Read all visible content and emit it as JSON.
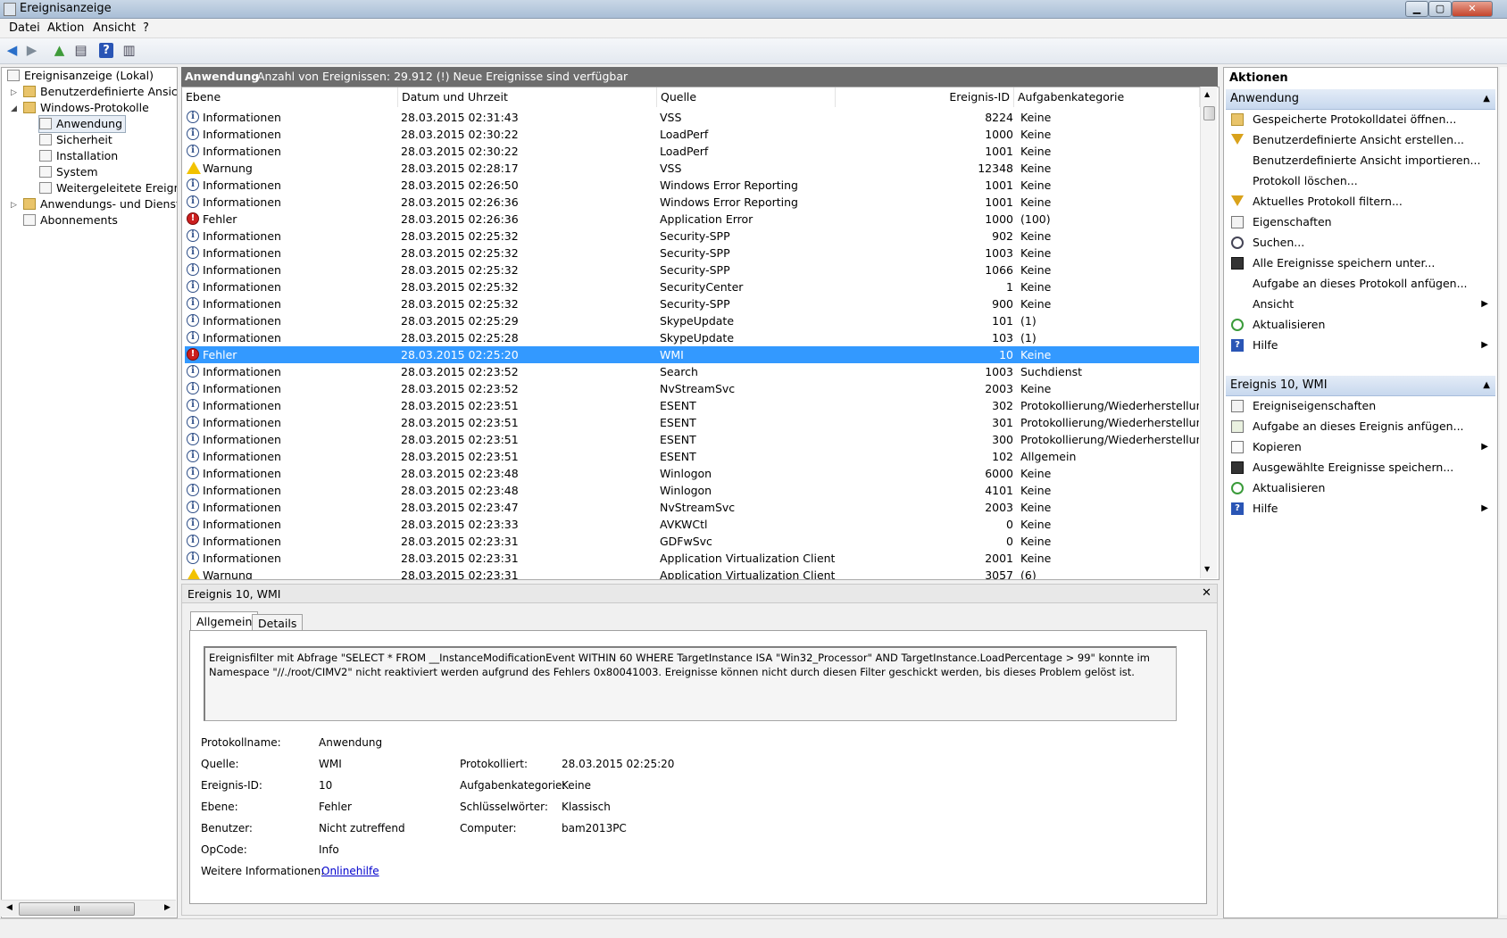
{
  "window": {
    "title": "Ereignisanzeige",
    "min": "▁",
    "max": "▢",
    "close": "✕"
  },
  "menu": [
    "Datei",
    "Aktion",
    "Ansicht",
    "?"
  ],
  "toolbar": {
    "back": "◀",
    "forward": "▶",
    "up": "▲",
    "console": "▤",
    "help": "?",
    "panel": "▥"
  },
  "tree": {
    "root": "Ereignisanzeige (Lokal)",
    "custom_views": "Benutzerdefinierte Ansichten",
    "windows_logs": "Windows-Protokolle",
    "logs": [
      "Anwendung",
      "Sicherheit",
      "Installation",
      "System",
      "Weitergeleitete Ereignisse"
    ],
    "app_services": "Anwendungs- und Dienstprotokolle",
    "subscriptions": "Abonnements",
    "scroll_grip": "III"
  },
  "center_header": {
    "name": "Anwendung",
    "info": "Anzahl von Ereignissen: 29.912 (!) Neue Ereignisse sind verfügbar"
  },
  "columns": [
    "Ebene",
    "Datum und Uhrzeit",
    "Quelle",
    "Ereignis-ID",
    "Aufgabenkategorie"
  ],
  "events": [
    {
      "level": "Informationen",
      "type": "info",
      "date": "28.03.2015 02:31:43",
      "source": "VSS",
      "id": "8224",
      "cat": "Keine"
    },
    {
      "level": "Informationen",
      "type": "info",
      "date": "28.03.2015 02:30:22",
      "source": "LoadPerf",
      "id": "1000",
      "cat": "Keine"
    },
    {
      "level": "Informationen",
      "type": "info",
      "date": "28.03.2015 02:30:22",
      "source": "LoadPerf",
      "id": "1001",
      "cat": "Keine"
    },
    {
      "level": "Warnung",
      "type": "warn",
      "date": "28.03.2015 02:28:17",
      "source": "VSS",
      "id": "12348",
      "cat": "Keine"
    },
    {
      "level": "Informationen",
      "type": "info",
      "date": "28.03.2015 02:26:50",
      "source": "Windows Error Reporting",
      "id": "1001",
      "cat": "Keine"
    },
    {
      "level": "Informationen",
      "type": "info",
      "date": "28.03.2015 02:26:36",
      "source": "Windows Error Reporting",
      "id": "1001",
      "cat": "Keine"
    },
    {
      "level": "Fehler",
      "type": "err",
      "date": "28.03.2015 02:26:36",
      "source": "Application Error",
      "id": "1000",
      "cat": "(100)"
    },
    {
      "level": "Informationen",
      "type": "info",
      "date": "28.03.2015 02:25:32",
      "source": "Security-SPP",
      "id": "902",
      "cat": "Keine"
    },
    {
      "level": "Informationen",
      "type": "info",
      "date": "28.03.2015 02:25:32",
      "source": "Security-SPP",
      "id": "1003",
      "cat": "Keine"
    },
    {
      "level": "Informationen",
      "type": "info",
      "date": "28.03.2015 02:25:32",
      "source": "Security-SPP",
      "id": "1066",
      "cat": "Keine"
    },
    {
      "level": "Informationen",
      "type": "info",
      "date": "28.03.2015 02:25:32",
      "source": "SecurityCenter",
      "id": "1",
      "cat": "Keine"
    },
    {
      "level": "Informationen",
      "type": "info",
      "date": "28.03.2015 02:25:32",
      "source": "Security-SPP",
      "id": "900",
      "cat": "Keine"
    },
    {
      "level": "Informationen",
      "type": "info",
      "date": "28.03.2015 02:25:29",
      "source": "SkypeUpdate",
      "id": "101",
      "cat": "(1)"
    },
    {
      "level": "Informationen",
      "type": "info",
      "date": "28.03.2015 02:25:28",
      "source": "SkypeUpdate",
      "id": "103",
      "cat": "(1)"
    },
    {
      "level": "Fehler",
      "type": "err",
      "date": "28.03.2015 02:25:20",
      "source": "WMI",
      "id": "10",
      "cat": "Keine",
      "selected": true
    },
    {
      "level": "Informationen",
      "type": "info",
      "date": "28.03.2015 02:23:52",
      "source": "Search",
      "id": "1003",
      "cat": "Suchdienst"
    },
    {
      "level": "Informationen",
      "type": "info",
      "date": "28.03.2015 02:23:52",
      "source": "NvStreamSvc",
      "id": "2003",
      "cat": "Keine"
    },
    {
      "level": "Informationen",
      "type": "info",
      "date": "28.03.2015 02:23:51",
      "source": "ESENT",
      "id": "302",
      "cat": "Protokollierung/Wiederherstellung"
    },
    {
      "level": "Informationen",
      "type": "info",
      "date": "28.03.2015 02:23:51",
      "source": "ESENT",
      "id": "301",
      "cat": "Protokollierung/Wiederherstellung"
    },
    {
      "level": "Informationen",
      "type": "info",
      "date": "28.03.2015 02:23:51",
      "source": "ESENT",
      "id": "300",
      "cat": "Protokollierung/Wiederherstellung"
    },
    {
      "level": "Informationen",
      "type": "info",
      "date": "28.03.2015 02:23:51",
      "source": "ESENT",
      "id": "102",
      "cat": "Allgemein"
    },
    {
      "level": "Informationen",
      "type": "info",
      "date": "28.03.2015 02:23:48",
      "source": "Winlogon",
      "id": "6000",
      "cat": "Keine"
    },
    {
      "level": "Informationen",
      "type": "info",
      "date": "28.03.2015 02:23:48",
      "source": "Winlogon",
      "id": "4101",
      "cat": "Keine"
    },
    {
      "level": "Informationen",
      "type": "info",
      "date": "28.03.2015 02:23:47",
      "source": "NvStreamSvc",
      "id": "2003",
      "cat": "Keine"
    },
    {
      "level": "Informationen",
      "type": "info",
      "date": "28.03.2015 02:23:33",
      "source": "AVKWCtl",
      "id": "0",
      "cat": "Keine"
    },
    {
      "level": "Informationen",
      "type": "info",
      "date": "28.03.2015 02:23:31",
      "source": "GDFwSvc",
      "id": "0",
      "cat": "Keine"
    },
    {
      "level": "Informationen",
      "type": "info",
      "date": "28.03.2015 02:23:31",
      "source": "Application Virtualization Client",
      "id": "2001",
      "cat": "Keine"
    },
    {
      "level": "Warnung",
      "type": "warn",
      "date": "28.03.2015 02:23:31",
      "source": "Application Virtualization Client",
      "id": "3057",
      "cat": "(6)"
    }
  ],
  "detail": {
    "title": "Ereignis 10, WMI",
    "close": "✕",
    "tabs": [
      "Allgemein",
      "Details"
    ],
    "description": "Ereignisfilter mit Abfrage \"SELECT * FROM __InstanceModificationEvent WITHIN 60 WHERE TargetInstance ISA \"Win32_Processor\" AND TargetInstance.LoadPercentage > 99\" konnte im Namespace \"//./root/CIMV2\" nicht reaktiviert werden aufgrund des Fehlers 0x80041003. Ereignisse können nicht durch diesen Filter geschickt werden, bis dieses Problem gelöst ist.",
    "labels": {
      "logname": "Protokollname:",
      "source": "Quelle:",
      "event_id": "Ereignis-ID:",
      "level": "Ebene:",
      "user": "Benutzer:",
      "opcode": "OpCode:",
      "more": "Weitere Informationen:",
      "logged": "Protokolliert:",
      "task": "Aufgabenkategorie:",
      "keywords": "Schlüsselwörter:",
      "computer": "Computer:"
    },
    "values": {
      "logname": "Anwendung",
      "source": "WMI",
      "event_id": "10",
      "level": "Fehler",
      "user": "Nicht zutreffend",
      "opcode": "Info",
      "more": "Onlinehilfe",
      "logged": "28.03.2015 02:25:20",
      "task": "Keine",
      "keywords": "Klassisch",
      "computer": "bam2013PC"
    }
  },
  "actions": {
    "title": "Aktionen",
    "section1": "Anwendung",
    "items1": [
      {
        "label": "Gespeicherte Protokolldatei öffnen...",
        "icon": "folder-open-icon"
      },
      {
        "label": "Benutzerdefinierte Ansicht erstellen...",
        "icon": "filter-icon"
      },
      {
        "label": "Benutzerdefinierte Ansicht importieren...",
        "icon": ""
      },
      {
        "label": "Protokoll löschen...",
        "icon": ""
      },
      {
        "label": "Aktuelles Protokoll filtern...",
        "icon": "filter-icon"
      },
      {
        "label": "Eigenschaften",
        "icon": "properties-icon"
      },
      {
        "label": "Suchen...",
        "icon": "binoculars-icon"
      },
      {
        "label": "Alle Ereignisse speichern unter...",
        "icon": "save-icon"
      },
      {
        "label": "Aufgabe an dieses Protokoll anfügen...",
        "icon": ""
      },
      {
        "label": "Ansicht",
        "icon": "",
        "submenu": true
      },
      {
        "label": "Aktualisieren",
        "icon": "refresh-icon"
      },
      {
        "label": "Hilfe",
        "icon": "help-icon",
        "submenu": true
      }
    ],
    "section2": "Ereignis 10, WMI",
    "items2": [
      {
        "label": "Ereigniseigenschaften",
        "icon": "properties-icon"
      },
      {
        "label": "Aufgabe an dieses Ereignis anfügen...",
        "icon": "task-icon"
      },
      {
        "label": "Kopieren",
        "icon": "copy-icon",
        "submenu": true
      },
      {
        "label": "Ausgewählte Ereignisse speichern...",
        "icon": "save-icon"
      },
      {
        "label": "Aktualisieren",
        "icon": "refresh-icon"
      },
      {
        "label": "Hilfe",
        "icon": "help-icon",
        "submenu": true
      }
    ],
    "collapse": "▲",
    "submenu_arrow": "▶"
  }
}
